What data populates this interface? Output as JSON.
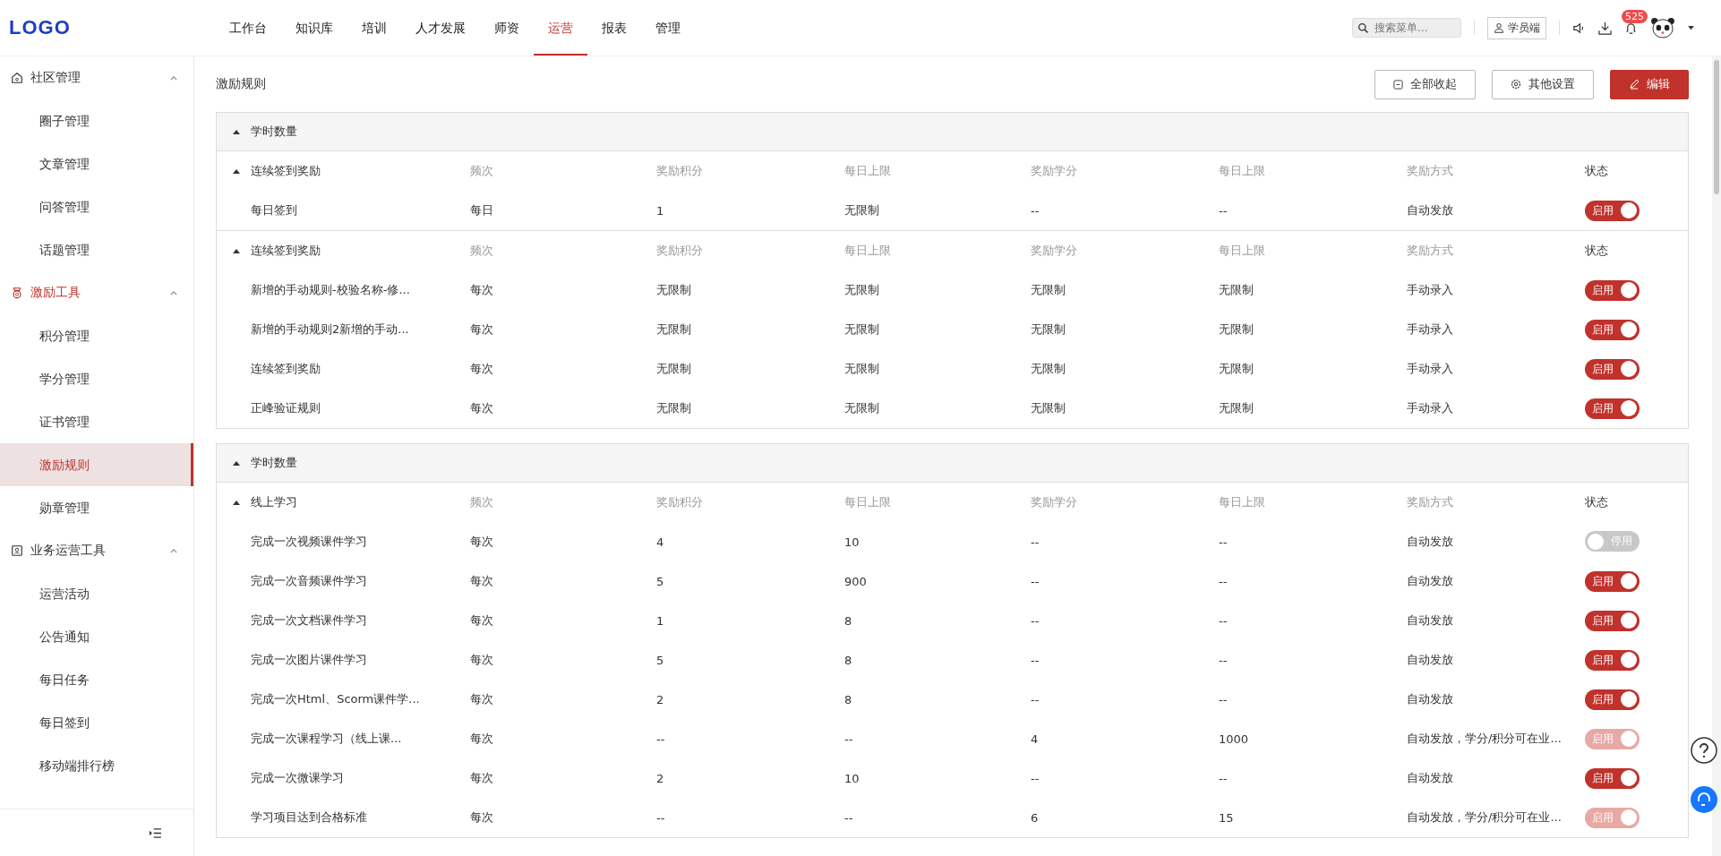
{
  "header": {
    "logo": "LOGO",
    "menu": [
      {
        "label": "工作台",
        "selected": false
      },
      {
        "label": "知识库",
        "selected": false
      },
      {
        "label": "培训",
        "selected": false
      },
      {
        "label": "人才发展",
        "selected": false
      },
      {
        "label": "师资",
        "selected": false
      },
      {
        "label": "运营",
        "selected": true
      },
      {
        "label": "报表",
        "selected": false
      },
      {
        "label": "管理",
        "selected": false
      }
    ],
    "search_placeholder": "搜索菜单...",
    "student_button": "学员端",
    "notification_count": "525"
  },
  "sidebar": [
    {
      "label": "社区管理",
      "expanded": true,
      "active": false,
      "children": [
        {
          "label": "圈子管理",
          "selected": false
        },
        {
          "label": "文章管理",
          "selected": false
        },
        {
          "label": "问答管理",
          "selected": false
        },
        {
          "label": "话题管理",
          "selected": false
        }
      ]
    },
    {
      "label": "激励工具",
      "expanded": true,
      "active": true,
      "children": [
        {
          "label": "积分管理",
          "selected": false
        },
        {
          "label": "学分管理",
          "selected": false
        },
        {
          "label": "证书管理",
          "selected": false
        },
        {
          "label": "激励规则",
          "selected": true
        },
        {
          "label": "勋章管理",
          "selected": false
        }
      ]
    },
    {
      "label": "业务运营工具",
      "expanded": true,
      "active": false,
      "children": [
        {
          "label": "运营活动",
          "selected": false
        },
        {
          "label": "公告通知",
          "selected": false
        },
        {
          "label": "每日任务",
          "selected": false
        },
        {
          "label": "每日签到",
          "selected": false
        },
        {
          "label": "移动端排行榜",
          "selected": false
        }
      ]
    }
  ],
  "page_title": "激励规则",
  "actions": [
    {
      "label": "全部收起",
      "kind": "collapse"
    },
    {
      "label": "其他设置",
      "kind": "settings"
    },
    {
      "label": "编辑",
      "kind": "edit"
    }
  ],
  "sections": [
    {
      "title": "学时数量",
      "expanded": true,
      "groups": [
        {
          "expanded": true,
          "columns": [
            "连续签到奖励",
            "频次",
            "奖励积分",
            "每日上限",
            "奖励学分",
            "每日上限",
            "奖励方式",
            "状态"
          ],
          "rows": [
            {
              "cells": [
                "每日签到",
                "每日",
                "1",
                "无限制",
                "--",
                "--",
                "自动发放"
              ],
              "status": {
                "label": "启用",
                "on": true,
                "disabled": false
              }
            }
          ]
        },
        {
          "expanded": true,
          "columns": [
            "连续签到奖励",
            "频次",
            "奖励积分",
            "每日上限",
            "奖励学分",
            "每日上限",
            "奖励方式",
            "状态"
          ],
          "rows": [
            {
              "cells": [
                "新增的手动规则-校验名称-修...",
                "每次",
                "无限制",
                "无限制",
                "无限制",
                "无限制",
                "手动录入"
              ],
              "status": {
                "label": "启用",
                "on": true,
                "disabled": false
              }
            },
            {
              "cells": [
                "新增的手动规则2新增的手动...",
                "每次",
                "无限制",
                "无限制",
                "无限制",
                "无限制",
                "手动录入"
              ],
              "status": {
                "label": "启用",
                "on": true,
                "disabled": false
              }
            },
            {
              "cells": [
                "连续签到奖励",
                "每次",
                "无限制",
                "无限制",
                "无限制",
                "无限制",
                "手动录入"
              ],
              "status": {
                "label": "启用",
                "on": true,
                "disabled": false
              }
            },
            {
              "cells": [
                "正峰验证规则",
                "每次",
                "无限制",
                "无限制",
                "无限制",
                "无限制",
                "手动录入"
              ],
              "status": {
                "label": "启用",
                "on": true,
                "disabled": false
              }
            }
          ]
        }
      ]
    },
    {
      "title": "学时数量",
      "expanded": true,
      "groups": [
        {
          "expanded": true,
          "columns": [
            "线上学习",
            "频次",
            "奖励积分",
            "每日上限",
            "奖励学分",
            "每日上限",
            "奖励方式",
            "状态"
          ],
          "rows": [
            {
              "cells": [
                "完成一次视频课件学习",
                "每次",
                "4",
                "10",
                "--",
                "--",
                "自动发放"
              ],
              "status": {
                "label": "停用",
                "on": false,
                "disabled": false
              }
            },
            {
              "cells": [
                "完成一次音频课件学习",
                "每次",
                "5",
                "900",
                "--",
                "--",
                "自动发放"
              ],
              "status": {
                "label": "启用",
                "on": true,
                "disabled": false
              }
            },
            {
              "cells": [
                "完成一次文档课件学习",
                "每次",
                "1",
                "8",
                "--",
                "--",
                "自动发放"
              ],
              "status": {
                "label": "启用",
                "on": true,
                "disabled": false
              }
            },
            {
              "cells": [
                "完成一次图片课件学习",
                "每次",
                "5",
                "8",
                "--",
                "--",
                "自动发放"
              ],
              "status": {
                "label": "启用",
                "on": true,
                "disabled": false
              }
            },
            {
              "cells": [
                "完成一次Html、Scorm课件学...",
                "每次",
                "2",
                "8",
                "--",
                "--",
                "自动发放"
              ],
              "status": {
                "label": "启用",
                "on": true,
                "disabled": false
              }
            },
            {
              "cells": [
                "完成一次课程学习（线上课...",
                "每次",
                "--",
                "--",
                "4",
                "1000",
                "自动发放，学分/积分可在业..."
              ],
              "status": {
                "label": "启用",
                "on": true,
                "disabled": true
              }
            },
            {
              "cells": [
                "完成一次微课学习",
                "每次",
                "2",
                "10",
                "--",
                "--",
                "自动发放"
              ],
              "status": {
                "label": "启用",
                "on": true,
                "disabled": false
              }
            },
            {
              "cells": [
                "学习项目达到合格标准",
                "每次",
                "--",
                "--",
                "6",
                "15",
                "自动发放，学分/积分可在业..."
              ],
              "status": {
                "label": "启用",
                "on": true,
                "disabled": true
              }
            }
          ]
        }
      ]
    }
  ]
}
